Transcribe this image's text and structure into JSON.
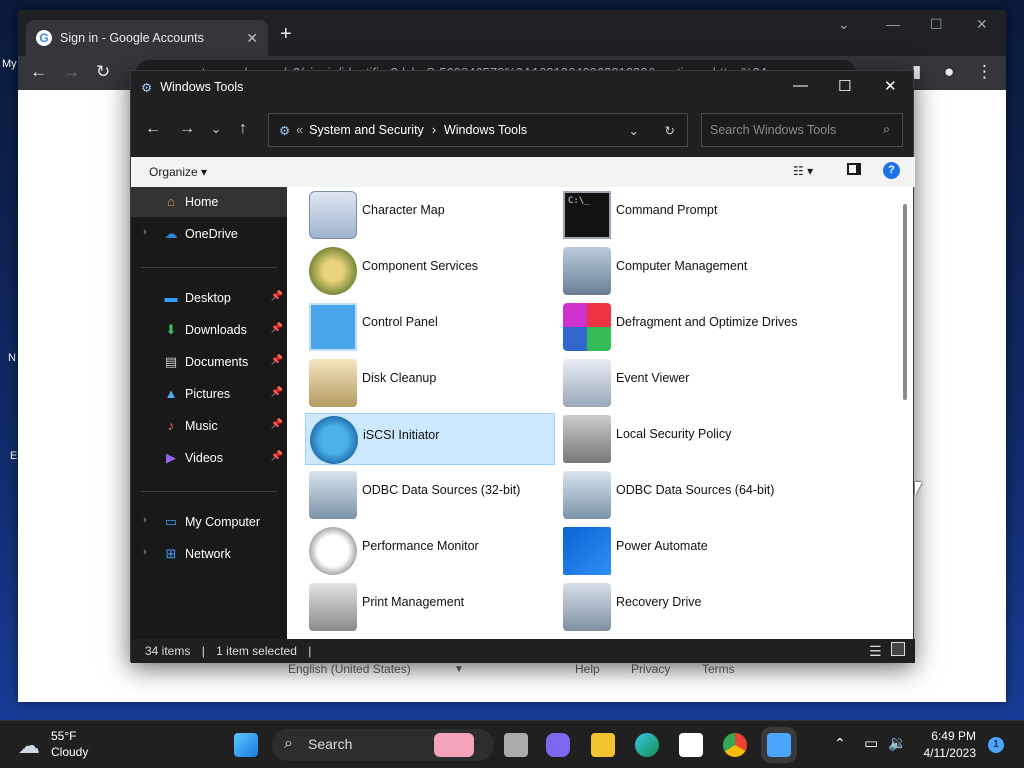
{
  "desktop": {
    "labels": [
      "My",
      "N",
      "E"
    ]
  },
  "chrome": {
    "tab_title": "Sign in - Google Accounts",
    "tab_close": "✕",
    "new_tab": "+",
    "url": "accounts.google.com/v3/signin/identifier?dsh=S-569846578%3A1681264096281338&continue=https%3A",
    "footer": {
      "language": "English (United States)",
      "help": "Help",
      "privacy": "Privacy",
      "terms": "Terms"
    }
  },
  "explorer": {
    "title": "Windows Tools",
    "address": {
      "parent": "System and Security",
      "current": "Windows Tools"
    },
    "search_placeholder": "Search Windows Tools",
    "organize": "Organize",
    "nav": [
      {
        "label": "Home"
      },
      {
        "label": "OneDrive"
      },
      {
        "label": "Desktop"
      },
      {
        "label": "Downloads"
      },
      {
        "label": "Documents"
      },
      {
        "label": "Pictures"
      },
      {
        "label": "Music"
      },
      {
        "label": "Videos"
      },
      {
        "label": "My Computer"
      },
      {
        "label": "Network"
      }
    ],
    "items": [
      {
        "name": "Character Map",
        "icon": "charmap-icon"
      },
      {
        "name": "Command Prompt",
        "icon": "cmd-icon"
      },
      {
        "name": "Component Services",
        "icon": "component-services-icon"
      },
      {
        "name": "Computer Management",
        "icon": "computer-management-icon"
      },
      {
        "name": "Control Panel",
        "icon": "control-panel-icon"
      },
      {
        "name": "Defragment and Optimize Drives",
        "icon": "defrag-icon"
      },
      {
        "name": "Disk Cleanup",
        "icon": "disk-cleanup-icon"
      },
      {
        "name": "Event Viewer",
        "icon": "event-viewer-icon"
      },
      {
        "name": "iSCSI Initiator",
        "icon": "iscsi-icon",
        "selected": true
      },
      {
        "name": "Local Security Policy",
        "icon": "security-policy-icon"
      },
      {
        "name": "ODBC Data Sources (32-bit)",
        "icon": "odbc-icon"
      },
      {
        "name": "ODBC Data Sources (64-bit)",
        "icon": "odbc-icon"
      },
      {
        "name": "Performance Monitor",
        "icon": "perfmon-icon"
      },
      {
        "name": "Power Automate",
        "icon": "power-automate-icon"
      },
      {
        "name": "Print Management",
        "icon": "print-management-icon"
      },
      {
        "name": "Recovery Drive",
        "icon": "recovery-drive-icon"
      }
    ],
    "status": {
      "count": "34 items",
      "selected": "1 item selected"
    }
  },
  "taskbar": {
    "weather": {
      "temp": "55°F",
      "condition": "Cloudy"
    },
    "search_label": "Search",
    "time": "6:49 PM",
    "date": "4/11/2023",
    "notifications": "1"
  }
}
